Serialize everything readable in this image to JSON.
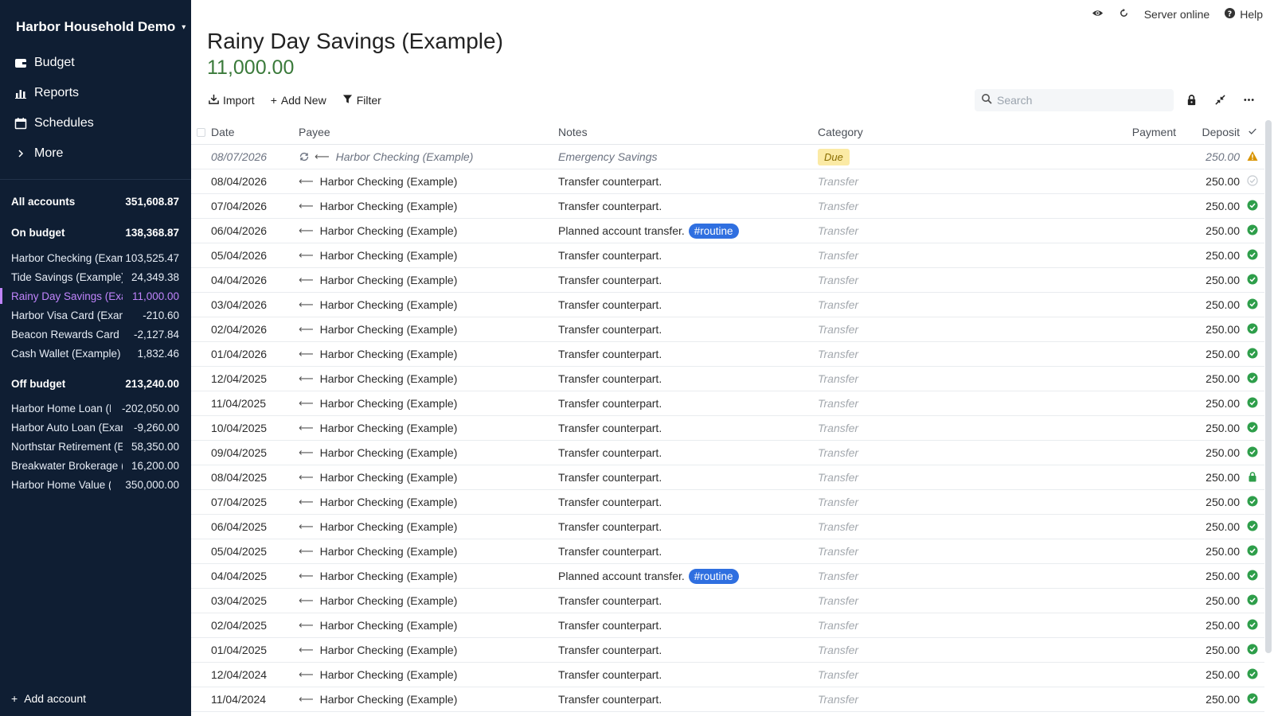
{
  "sidebar": {
    "budget_name": "Harbor Household Demo",
    "nav": [
      {
        "label": "Budget",
        "icon": "wallet-icon"
      },
      {
        "label": "Reports",
        "icon": "bar-chart-icon"
      },
      {
        "label": "Schedules",
        "icon": "calendar-icon"
      },
      {
        "label": "More",
        "icon": "chevron-right-icon"
      }
    ],
    "all_accounts": {
      "label": "All accounts",
      "balance": "351,608.87"
    },
    "on_budget": {
      "label": "On budget",
      "balance": "138,368.87",
      "accounts": [
        {
          "name": "Harbor Checking (Example)",
          "balance": "103,525.47"
        },
        {
          "name": "Tide Savings (Example)",
          "balance": "24,349.38"
        },
        {
          "name": "Rainy Day Savings (Example)",
          "balance": "11,000.00",
          "active": true
        },
        {
          "name": "Harbor Visa Card (Example)",
          "balance": "-210.60"
        },
        {
          "name": "Beacon Rewards Card (Example)",
          "balance": "-2,127.84"
        },
        {
          "name": "Cash Wallet (Example)",
          "balance": "1,832.46"
        }
      ]
    },
    "off_budget": {
      "label": "Off budget",
      "balance": "213,240.00",
      "accounts": [
        {
          "name": "Harbor Home Loan (Example)",
          "balance": "-202,050.00"
        },
        {
          "name": "Harbor Auto Loan (Example)",
          "balance": "-9,260.00"
        },
        {
          "name": "Northstar Retirement (Example)",
          "balance": "58,350.00"
        },
        {
          "name": "Breakwater Brokerage (Example)",
          "balance": "16,200.00"
        },
        {
          "name": "Harbor Home Value (Example)",
          "balance": "350,000.00"
        }
      ]
    },
    "add_account": "Add account"
  },
  "topbar": {
    "server_status": "Server online",
    "help": "Help"
  },
  "header": {
    "title": "Rainy Day Savings (Example)",
    "balance": "11,000.00"
  },
  "toolbar": {
    "import": "Import",
    "add_new": "Add New",
    "filter": "Filter",
    "search_placeholder": "Search"
  },
  "table": {
    "columns": {
      "date": "Date",
      "payee": "Payee",
      "notes": "Notes",
      "category": "Category",
      "payment": "Payment",
      "deposit": "Deposit"
    },
    "rows": [
      {
        "date": "08/07/2026",
        "payee": "Harbor Checking (Example)",
        "notes": "Emergency Savings",
        "tag": "",
        "category": "Due",
        "payment": "",
        "deposit": "250.00",
        "status": "warning",
        "scheduled": true
      },
      {
        "date": "08/04/2026",
        "payee": "Harbor Checking (Example)",
        "notes": "Transfer counterpart.",
        "tag": "",
        "category": "Transfer",
        "payment": "",
        "deposit": "250.00",
        "status": "uncleared"
      },
      {
        "date": "07/04/2026",
        "payee": "Harbor Checking (Example)",
        "notes": "Transfer counterpart.",
        "tag": "",
        "category": "Transfer",
        "payment": "",
        "deposit": "250.00",
        "status": "cleared"
      },
      {
        "date": "06/04/2026",
        "payee": "Harbor Checking (Example)",
        "notes": "Planned account transfer.",
        "tag": "#routine",
        "category": "Transfer",
        "payment": "",
        "deposit": "250.00",
        "status": "cleared"
      },
      {
        "date": "05/04/2026",
        "payee": "Harbor Checking (Example)",
        "notes": "Transfer counterpart.",
        "tag": "",
        "category": "Transfer",
        "payment": "",
        "deposit": "250.00",
        "status": "cleared"
      },
      {
        "date": "04/04/2026",
        "payee": "Harbor Checking (Example)",
        "notes": "Transfer counterpart.",
        "tag": "",
        "category": "Transfer",
        "payment": "",
        "deposit": "250.00",
        "status": "cleared"
      },
      {
        "date": "03/04/2026",
        "payee": "Harbor Checking (Example)",
        "notes": "Transfer counterpart.",
        "tag": "",
        "category": "Transfer",
        "payment": "",
        "deposit": "250.00",
        "status": "cleared"
      },
      {
        "date": "02/04/2026",
        "payee": "Harbor Checking (Example)",
        "notes": "Transfer counterpart.",
        "tag": "",
        "category": "Transfer",
        "payment": "",
        "deposit": "250.00",
        "status": "cleared"
      },
      {
        "date": "01/04/2026",
        "payee": "Harbor Checking (Example)",
        "notes": "Transfer counterpart.",
        "tag": "",
        "category": "Transfer",
        "payment": "",
        "deposit": "250.00",
        "status": "cleared"
      },
      {
        "date": "12/04/2025",
        "payee": "Harbor Checking (Example)",
        "notes": "Transfer counterpart.",
        "tag": "",
        "category": "Transfer",
        "payment": "",
        "deposit": "250.00",
        "status": "cleared"
      },
      {
        "date": "11/04/2025",
        "payee": "Harbor Checking (Example)",
        "notes": "Transfer counterpart.",
        "tag": "",
        "category": "Transfer",
        "payment": "",
        "deposit": "250.00",
        "status": "cleared"
      },
      {
        "date": "10/04/2025",
        "payee": "Harbor Checking (Example)",
        "notes": "Transfer counterpart.",
        "tag": "",
        "category": "Transfer",
        "payment": "",
        "deposit": "250.00",
        "status": "cleared"
      },
      {
        "date": "09/04/2025",
        "payee": "Harbor Checking (Example)",
        "notes": "Transfer counterpart.",
        "tag": "",
        "category": "Transfer",
        "payment": "",
        "deposit": "250.00",
        "status": "cleared"
      },
      {
        "date": "08/04/2025",
        "payee": "Harbor Checking (Example)",
        "notes": "Transfer counterpart.",
        "tag": "",
        "category": "Transfer",
        "payment": "",
        "deposit": "250.00",
        "status": "locked"
      },
      {
        "date": "07/04/2025",
        "payee": "Harbor Checking (Example)",
        "notes": "Transfer counterpart.",
        "tag": "",
        "category": "Transfer",
        "payment": "",
        "deposit": "250.00",
        "status": "cleared"
      },
      {
        "date": "06/04/2025",
        "payee": "Harbor Checking (Example)",
        "notes": "Transfer counterpart.",
        "tag": "",
        "category": "Transfer",
        "payment": "",
        "deposit": "250.00",
        "status": "cleared"
      },
      {
        "date": "05/04/2025",
        "payee": "Harbor Checking (Example)",
        "notes": "Transfer counterpart.",
        "tag": "",
        "category": "Transfer",
        "payment": "",
        "deposit": "250.00",
        "status": "cleared"
      },
      {
        "date": "04/04/2025",
        "payee": "Harbor Checking (Example)",
        "notes": "Planned account transfer.",
        "tag": "#routine",
        "category": "Transfer",
        "payment": "",
        "deposit": "250.00",
        "status": "cleared"
      },
      {
        "date": "03/04/2025",
        "payee": "Harbor Checking (Example)",
        "notes": "Transfer counterpart.",
        "tag": "",
        "category": "Transfer",
        "payment": "",
        "deposit": "250.00",
        "status": "cleared"
      },
      {
        "date": "02/04/2025",
        "payee": "Harbor Checking (Example)",
        "notes": "Transfer counterpart.",
        "tag": "",
        "category": "Transfer",
        "payment": "",
        "deposit": "250.00",
        "status": "cleared"
      },
      {
        "date": "01/04/2025",
        "payee": "Harbor Checking (Example)",
        "notes": "Transfer counterpart.",
        "tag": "",
        "category": "Transfer",
        "payment": "",
        "deposit": "250.00",
        "status": "cleared"
      },
      {
        "date": "12/04/2024",
        "payee": "Harbor Checking (Example)",
        "notes": "Transfer counterpart.",
        "tag": "",
        "category": "Transfer",
        "payment": "",
        "deposit": "250.00",
        "status": "cleared"
      },
      {
        "date": "11/04/2024",
        "payee": "Harbor Checking (Example)",
        "notes": "Transfer counterpart.",
        "tag": "",
        "category": "Transfer",
        "payment": "",
        "deposit": "250.00",
        "status": "cleared"
      }
    ]
  },
  "colors": {
    "sidebar_bg": "#0f1e33",
    "active_account": "#c084fc",
    "balance_green": "#3a7a3a",
    "cleared_green": "#2e9e4a",
    "warning": "#d99400",
    "tag_blue": "#2f6fe0",
    "due_badge": "#fbeaa5"
  }
}
